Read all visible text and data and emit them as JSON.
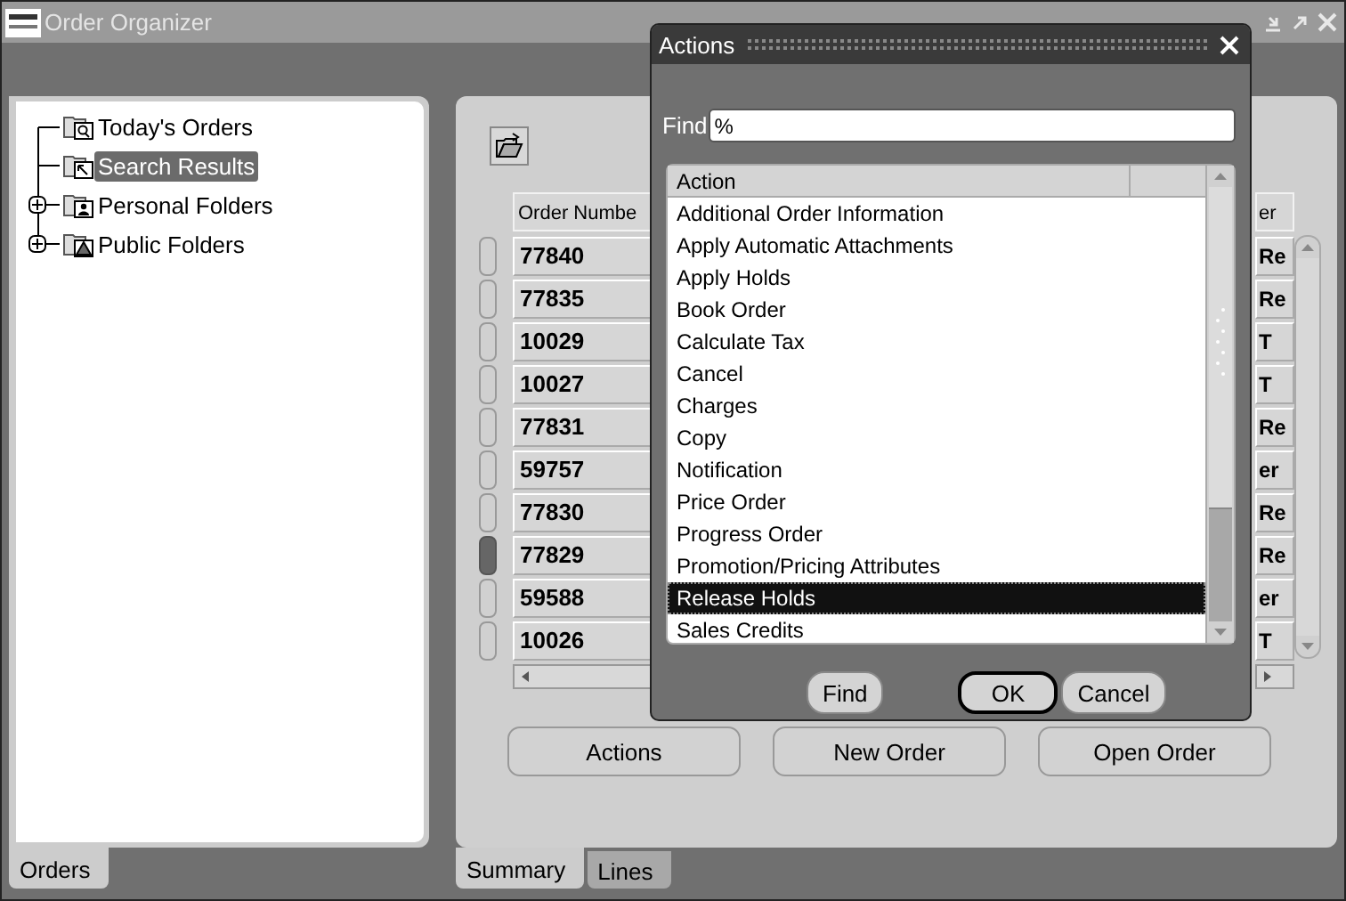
{
  "window": {
    "title": "Order Organizer"
  },
  "navigator": {
    "items": [
      {
        "label": "Today's Orders",
        "expandable": false,
        "selected": false
      },
      {
        "label": "Search Results",
        "expandable": false,
        "selected": true
      },
      {
        "label": "Personal Folders",
        "expandable": true,
        "selected": false
      },
      {
        "label": "Public Folders",
        "expandable": true,
        "selected": false
      }
    ]
  },
  "left_tabs": [
    {
      "label": "Orders",
      "selected": true
    }
  ],
  "table": {
    "columns": [
      "Order Numbe",
      "er"
    ],
    "rows": [
      {
        "cells": [
          "77840",
          "Re"
        ],
        "selected": false
      },
      {
        "cells": [
          "77835",
          "Re"
        ],
        "selected": false
      },
      {
        "cells": [
          "10029",
          "T"
        ],
        "selected": false
      },
      {
        "cells": [
          "10027",
          "T"
        ],
        "selected": false
      },
      {
        "cells": [
          "77831",
          "Re"
        ],
        "selected": false
      },
      {
        "cells": [
          "59757",
          "er"
        ],
        "selected": false
      },
      {
        "cells": [
          "77830",
          "Re"
        ],
        "selected": false
      },
      {
        "cells": [
          "77829",
          "Re"
        ],
        "selected": true
      },
      {
        "cells": [
          "59588",
          "er"
        ],
        "selected": false
      },
      {
        "cells": [
          "10026",
          "T"
        ],
        "selected": false
      }
    ]
  },
  "buttons": [
    "Actions",
    "New Order",
    "Open Order"
  ],
  "right_tabs": [
    {
      "label": "Summary",
      "selected": true
    },
    {
      "label": "Lines",
      "selected": false
    }
  ],
  "dialog": {
    "title": "Actions",
    "find_label": "Find",
    "find_value": "%",
    "list_header": "Action",
    "items": [
      {
        "label": "Additional Order Information",
        "selected": false
      },
      {
        "label": "Apply Automatic Attachments",
        "selected": false
      },
      {
        "label": "Apply Holds",
        "selected": false
      },
      {
        "label": "Book Order",
        "selected": false
      },
      {
        "label": "Calculate Tax",
        "selected": false
      },
      {
        "label": "Cancel",
        "selected": false
      },
      {
        "label": "Charges",
        "selected": false
      },
      {
        "label": "Copy",
        "selected": false
      },
      {
        "label": "Notification",
        "selected": false
      },
      {
        "label": "Price Order",
        "selected": false
      },
      {
        "label": "Progress Order",
        "selected": false
      },
      {
        "label": "Promotion/Pricing Attributes",
        "selected": false
      },
      {
        "label": "Release Holds",
        "selected": true
      },
      {
        "label": "Sales Credits",
        "selected": false
      }
    ],
    "buttons": [
      {
        "label": "Find",
        "kind": "normal"
      },
      {
        "label": "OK",
        "kind": "default"
      },
      {
        "label": "Cancel",
        "kind": "normal"
      }
    ]
  }
}
